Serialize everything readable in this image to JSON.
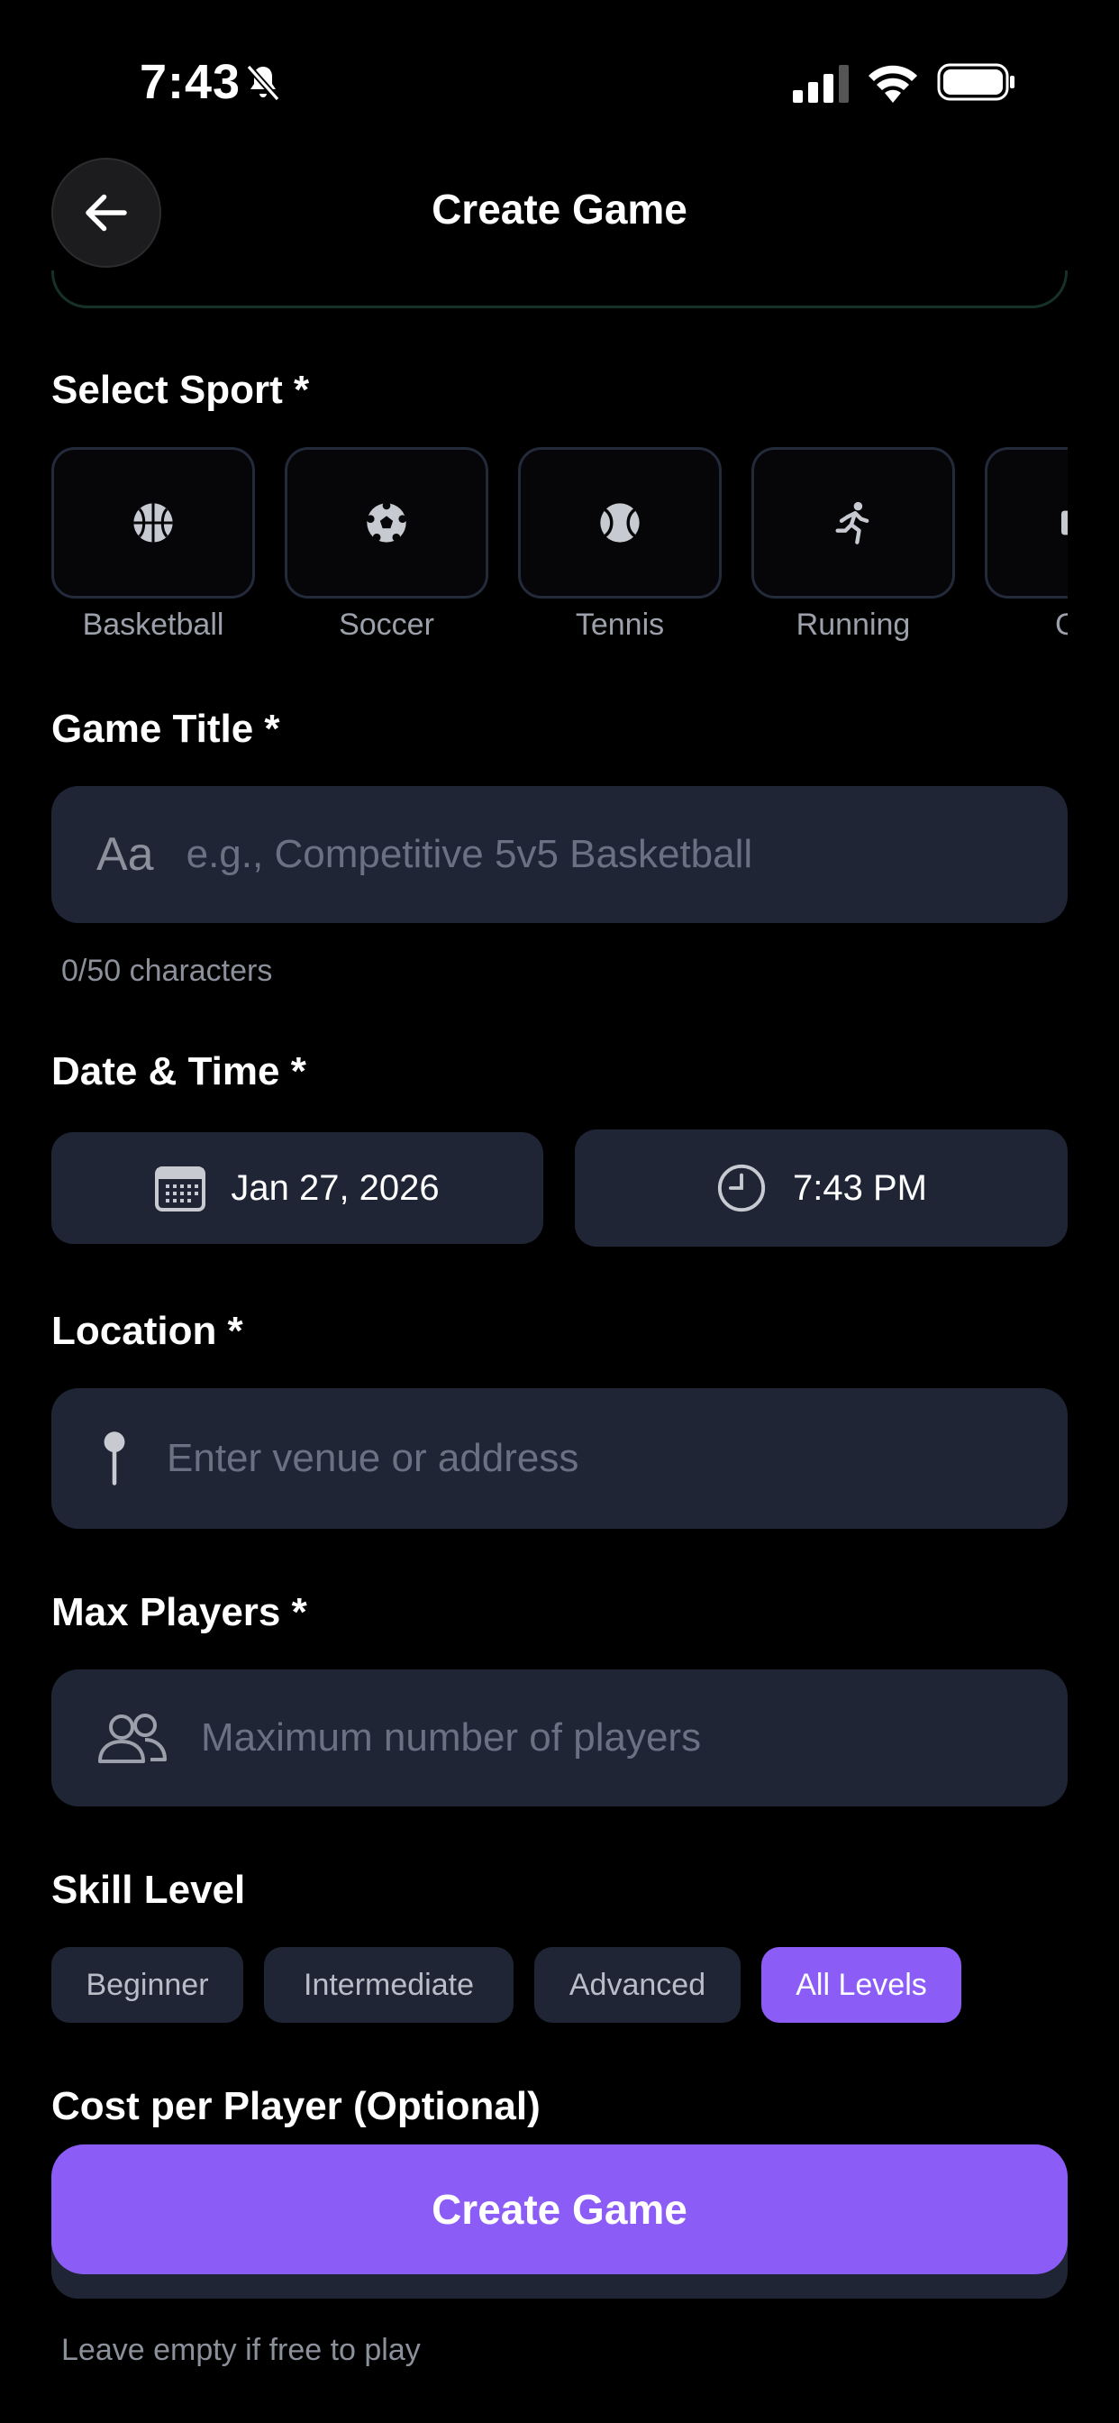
{
  "status_bar": {
    "time": "7:43"
  },
  "header": {
    "title": "Create Game"
  },
  "sport": {
    "label": "Select Sport *",
    "items": [
      {
        "label": "Basketball",
        "icon": "basketball-icon"
      },
      {
        "label": "Soccer",
        "icon": "soccer-ball-icon"
      },
      {
        "label": "Tennis",
        "icon": "tennis-ball-icon"
      },
      {
        "label": "Running",
        "icon": "running-icon"
      },
      {
        "label": "G",
        "icon": "sport-icon"
      }
    ]
  },
  "game_title": {
    "label": "Game Title *",
    "prefix": "Aa",
    "placeholder": "e.g., Competitive 5v5 Basketball",
    "counter": "0/50 characters"
  },
  "date_time": {
    "label": "Date & Time *",
    "date": "Jan 27, 2026",
    "time": "7:43 PM"
  },
  "location": {
    "label": "Location *",
    "placeholder": "Enter venue or address"
  },
  "max_players": {
    "label": "Max Players *",
    "placeholder": "Maximum number of players"
  },
  "skill_level": {
    "label": "Skill Level",
    "options": [
      "Beginner",
      "Intermediate",
      "Advanced",
      "All Levels"
    ],
    "selected": "All Levels"
  },
  "cost": {
    "label": "Cost per Player (Optional)",
    "hint": "Leave empty if free to play"
  },
  "actions": {
    "create_label": "Create Game"
  },
  "colors": {
    "accent": "#8b5cf6",
    "field_bg": "#1f2535",
    "background": "#000000"
  }
}
